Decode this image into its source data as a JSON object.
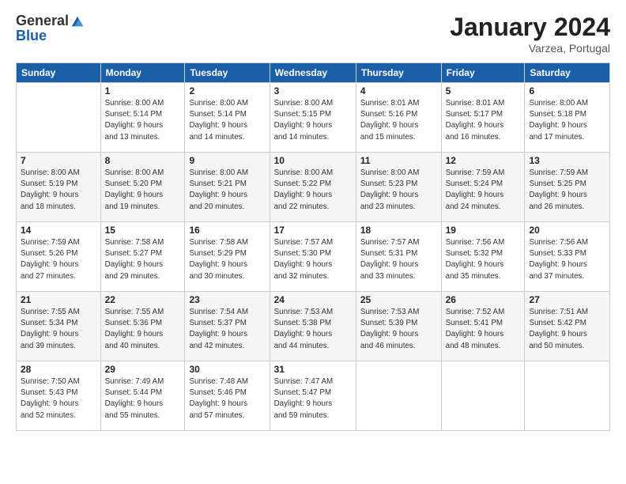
{
  "logo": {
    "general": "General",
    "blue": "Blue"
  },
  "title": "January 2024",
  "location": "Varzea, Portugal",
  "days_of_week": [
    "Sunday",
    "Monday",
    "Tuesday",
    "Wednesday",
    "Thursday",
    "Friday",
    "Saturday"
  ],
  "weeks": [
    [
      {
        "day": "",
        "info": ""
      },
      {
        "day": "1",
        "info": "Sunrise: 8:00 AM\nSunset: 5:14 PM\nDaylight: 9 hours\nand 13 minutes."
      },
      {
        "day": "2",
        "info": "Sunrise: 8:00 AM\nSunset: 5:14 PM\nDaylight: 9 hours\nand 14 minutes."
      },
      {
        "day": "3",
        "info": "Sunrise: 8:00 AM\nSunset: 5:15 PM\nDaylight: 9 hours\nand 14 minutes."
      },
      {
        "day": "4",
        "info": "Sunrise: 8:01 AM\nSunset: 5:16 PM\nDaylight: 9 hours\nand 15 minutes."
      },
      {
        "day": "5",
        "info": "Sunrise: 8:01 AM\nSunset: 5:17 PM\nDaylight: 9 hours\nand 16 minutes."
      },
      {
        "day": "6",
        "info": "Sunrise: 8:00 AM\nSunset: 5:18 PM\nDaylight: 9 hours\nand 17 minutes."
      }
    ],
    [
      {
        "day": "7",
        "info": "Sunrise: 8:00 AM\nSunset: 5:19 PM\nDaylight: 9 hours\nand 18 minutes."
      },
      {
        "day": "8",
        "info": "Sunrise: 8:00 AM\nSunset: 5:20 PM\nDaylight: 9 hours\nand 19 minutes."
      },
      {
        "day": "9",
        "info": "Sunrise: 8:00 AM\nSunset: 5:21 PM\nDaylight: 9 hours\nand 20 minutes."
      },
      {
        "day": "10",
        "info": "Sunrise: 8:00 AM\nSunset: 5:22 PM\nDaylight: 9 hours\nand 22 minutes."
      },
      {
        "day": "11",
        "info": "Sunrise: 8:00 AM\nSunset: 5:23 PM\nDaylight: 9 hours\nand 23 minutes."
      },
      {
        "day": "12",
        "info": "Sunrise: 7:59 AM\nSunset: 5:24 PM\nDaylight: 9 hours\nand 24 minutes."
      },
      {
        "day": "13",
        "info": "Sunrise: 7:59 AM\nSunset: 5:25 PM\nDaylight: 9 hours\nand 26 minutes."
      }
    ],
    [
      {
        "day": "14",
        "info": "Sunrise: 7:59 AM\nSunset: 5:26 PM\nDaylight: 9 hours\nand 27 minutes."
      },
      {
        "day": "15",
        "info": "Sunrise: 7:58 AM\nSunset: 5:27 PM\nDaylight: 9 hours\nand 29 minutes."
      },
      {
        "day": "16",
        "info": "Sunrise: 7:58 AM\nSunset: 5:29 PM\nDaylight: 9 hours\nand 30 minutes."
      },
      {
        "day": "17",
        "info": "Sunrise: 7:57 AM\nSunset: 5:30 PM\nDaylight: 9 hours\nand 32 minutes."
      },
      {
        "day": "18",
        "info": "Sunrise: 7:57 AM\nSunset: 5:31 PM\nDaylight: 9 hours\nand 33 minutes."
      },
      {
        "day": "19",
        "info": "Sunrise: 7:56 AM\nSunset: 5:32 PM\nDaylight: 9 hours\nand 35 minutes."
      },
      {
        "day": "20",
        "info": "Sunrise: 7:56 AM\nSunset: 5:33 PM\nDaylight: 9 hours\nand 37 minutes."
      }
    ],
    [
      {
        "day": "21",
        "info": "Sunrise: 7:55 AM\nSunset: 5:34 PM\nDaylight: 9 hours\nand 39 minutes."
      },
      {
        "day": "22",
        "info": "Sunrise: 7:55 AM\nSunset: 5:36 PM\nDaylight: 9 hours\nand 40 minutes."
      },
      {
        "day": "23",
        "info": "Sunrise: 7:54 AM\nSunset: 5:37 PM\nDaylight: 9 hours\nand 42 minutes."
      },
      {
        "day": "24",
        "info": "Sunrise: 7:53 AM\nSunset: 5:38 PM\nDaylight: 9 hours\nand 44 minutes."
      },
      {
        "day": "25",
        "info": "Sunrise: 7:53 AM\nSunset: 5:39 PM\nDaylight: 9 hours\nand 46 minutes."
      },
      {
        "day": "26",
        "info": "Sunrise: 7:52 AM\nSunset: 5:41 PM\nDaylight: 9 hours\nand 48 minutes."
      },
      {
        "day": "27",
        "info": "Sunrise: 7:51 AM\nSunset: 5:42 PM\nDaylight: 9 hours\nand 50 minutes."
      }
    ],
    [
      {
        "day": "28",
        "info": "Sunrise: 7:50 AM\nSunset: 5:43 PM\nDaylight: 9 hours\nand 52 minutes."
      },
      {
        "day": "29",
        "info": "Sunrise: 7:49 AM\nSunset: 5:44 PM\nDaylight: 9 hours\nand 55 minutes."
      },
      {
        "day": "30",
        "info": "Sunrise: 7:48 AM\nSunset: 5:46 PM\nDaylight: 9 hours\nand 57 minutes."
      },
      {
        "day": "31",
        "info": "Sunrise: 7:47 AM\nSunset: 5:47 PM\nDaylight: 9 hours\nand 59 minutes."
      },
      {
        "day": "",
        "info": ""
      },
      {
        "day": "",
        "info": ""
      },
      {
        "day": "",
        "info": ""
      }
    ]
  ]
}
